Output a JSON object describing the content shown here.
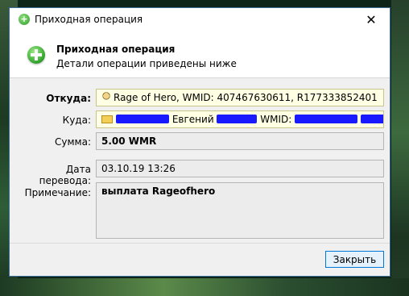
{
  "window": {
    "title": "Приходная операция",
    "close_glyph": "✕"
  },
  "header": {
    "title": "Приходная операция",
    "subtitle": "Детали операции приведены ниже"
  },
  "fields": {
    "from": {
      "label": "Откуда:",
      "value": "Rage of Hero, WMID: 407467630611, R177333852401"
    },
    "to": {
      "label": "Куда:",
      "name": "Евгений",
      "wmid_label": "WMID:"
    },
    "amount": {
      "label": "Сумма:",
      "value": "5.00 WMR"
    },
    "date": {
      "label": "Дата перевода:",
      "value": "03.10.19 13:26"
    },
    "note": {
      "label": "Примечание:",
      "value": "выплата Rageofhero"
    }
  },
  "buttons": {
    "close_label": "Закрыть"
  },
  "icons": {
    "app": "green-plus-icon",
    "header": "green-plus-icon",
    "from": "person-icon",
    "to": "wallet-card-icon",
    "close": "close-icon"
  },
  "colors": {
    "redaction": "#1a1aff",
    "from_field_bg": "#ffffe3",
    "button_border": "#0078d7"
  }
}
